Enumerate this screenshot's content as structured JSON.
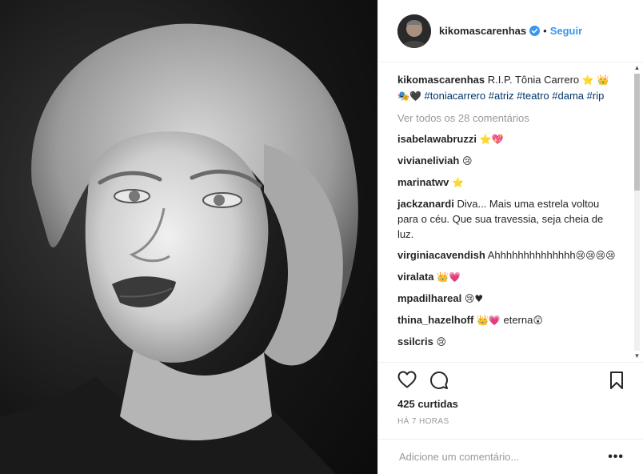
{
  "post": {
    "username": "kikomascarenhas",
    "follow_label": "Seguir",
    "dot": "•",
    "caption": {
      "username": "kikomascarenhas",
      "text": "R.I.P. Tônia Carrero",
      "emoji1": "⭐ 👑",
      "emoji2": "🎭🖤",
      "tags": [
        "#toniacarrero",
        "#atriz",
        "#teatro",
        "#dama",
        "#rip"
      ]
    },
    "view_all": "Ver todos os 28 comentários",
    "comments": [
      {
        "user": "isabelawabruzzi",
        "text": "",
        "emoji": "⭐💖"
      },
      {
        "user": "vivianeliviah",
        "text": "",
        "emoji": "😢"
      },
      {
        "user": "marinatwv",
        "text": "",
        "emoji": "⭐"
      },
      {
        "user": "jackzanardi",
        "text": "Diva... Mais uma estrela voltou para o céu. Que sua travessia, seja cheia de luz.",
        "emoji": ""
      },
      {
        "user": "virginiacavendish",
        "text": "Ahhhhhhhhhhhhhh",
        "emoji": "😢😢😢😢"
      },
      {
        "user": "viralata",
        "text": "",
        "emoji": "👑💗"
      },
      {
        "user": "mpadilhareal",
        "text": "",
        "emoji": "😢♥"
      },
      {
        "user": "thina_hazelhoff",
        "text": "eterna",
        "emoji_before": "👑💗",
        "emoji": "😲"
      },
      {
        "user": "ssilcris",
        "text": "",
        "emoji": "😢"
      }
    ],
    "likes_count": "425",
    "likes_label": "curtidas",
    "time_ago": "HÁ 7 HORAS",
    "add_comment_placeholder": "Adicione um comentário...",
    "more_label": "•••",
    "colors": {
      "link": "#3897f0",
      "hashtag": "#003569",
      "muted": "#999999",
      "verified": "#3897f0"
    }
  }
}
